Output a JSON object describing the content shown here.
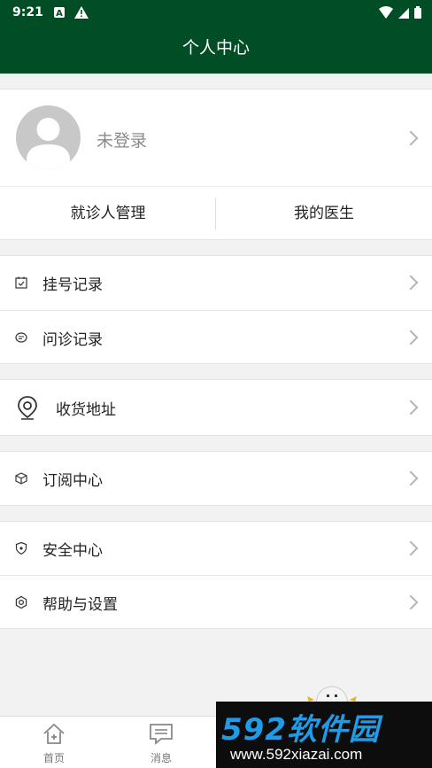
{
  "status_bar": {
    "time": "9:21"
  },
  "header": {
    "title": "个人中心"
  },
  "profile": {
    "login_text": "未登录",
    "actions": [
      "就诊人管理",
      "我的医生"
    ]
  },
  "menu": [
    {
      "label": "挂号记录",
      "icon": "calendar-check-icon"
    },
    {
      "label": "问诊记录",
      "icon": "chat-bubble-icon"
    },
    {
      "label": "收货地址",
      "icon": "location-pin-icon"
    },
    {
      "label": "订阅中心",
      "icon": "cube-icon"
    },
    {
      "label": "安全中心",
      "icon": "shield-icon"
    },
    {
      "label": "帮助与设置",
      "icon": "settings-gear-icon"
    }
  ],
  "tabbar": {
    "tabs": [
      "首页",
      "消息"
    ]
  },
  "watermark": {
    "brand": "592软件园",
    "url": "www.592xiazai.com"
  },
  "colors": {
    "primary": "#014d26",
    "background": "#f2f2f2",
    "watermark_blue": "#1f9be8"
  }
}
